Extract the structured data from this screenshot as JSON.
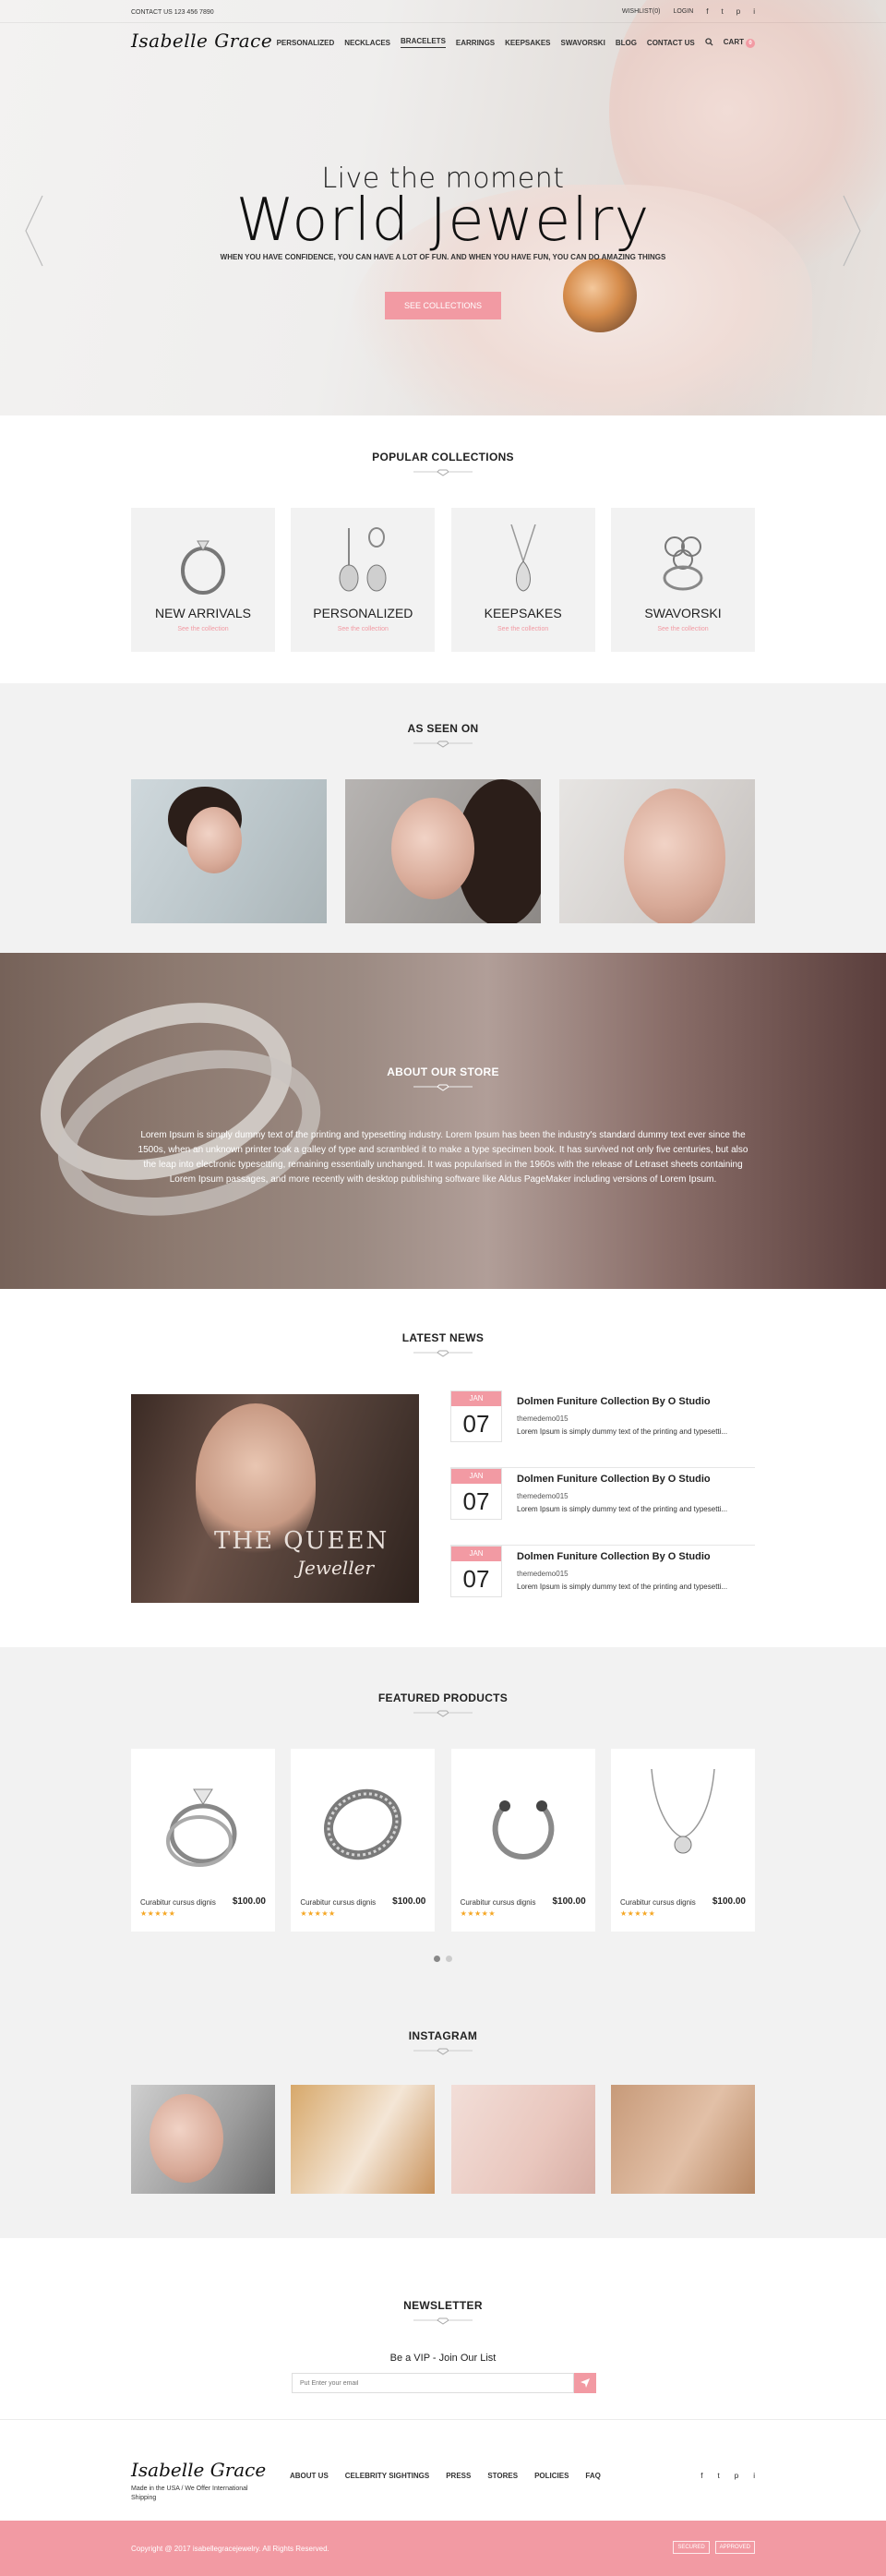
{
  "topbar": {
    "contact": "CONTACT US   123 456 7890",
    "wishlist": "WISHLIST(0)",
    "login": "LOGIN",
    "social": [
      "f",
      "t",
      "p",
      "i"
    ]
  },
  "brand": {
    "logo": "Isabelle Grace"
  },
  "nav": {
    "items": [
      "PERSONALIZED",
      "NECKLACES",
      "BRACELETS",
      "EARRINGS",
      "KEEPSAKES",
      "SWAVORSKI",
      "BLOG",
      "CONTACT US"
    ],
    "active_index": 2,
    "cart_label": "CART",
    "cart_count": "0"
  },
  "hero": {
    "subtitle": "Live the moment",
    "title": "World Jewelry",
    "tagline": "WHEN YOU HAVE CONFIDENCE, YOU CAN HAVE A LOT OF FUN. AND WHEN YOU HAVE FUN, YOU CAN DO AMAZING THINGS",
    "cta": "SEE COLLECTIONS"
  },
  "popular": {
    "title": "POPULAR COLLECTIONS",
    "items": [
      {
        "name": "NEW ARRIVALS",
        "link": "See the collection"
      },
      {
        "name": "PERSONALIZED",
        "link": "See the collection"
      },
      {
        "name": "KEEPSAKES",
        "link": "See the collection"
      },
      {
        "name": "SWAVORSKI",
        "link": "See the collection"
      }
    ]
  },
  "seen": {
    "title": "AS SEEN ON"
  },
  "about": {
    "title": "ABOUT OUR STORE",
    "text": "Lorem Ipsum is simply dummy text of the printing and typesetting industry. Lorem Ipsum has been the industry's standard dummy text ever since the 1500s, when an unknown printer took a galley of type and scrambled it to make a type specimen book. It has survived not only five centuries, but also the leap into electronic typesetting, remaining essentially unchanged. It was popularised in the 1960s with the release of Letraset sheets containing Lorem Ipsum passages, and more recently with desktop publishing software like Aldus PageMaker including versions of Lorem Ipsum."
  },
  "news": {
    "title": "LATEST NEWS",
    "feature_title": "THE QUEEN",
    "feature_sub": "Jeweller",
    "items": [
      {
        "month": "JAN",
        "day": "07",
        "title": "Dolmen Funiture Collection By O Studio",
        "author": "themedemo015",
        "excerpt": "Lorem Ipsum is simply dummy text of the printing and typesetti..."
      },
      {
        "month": "JAN",
        "day": "07",
        "title": "Dolmen Funiture Collection By O Studio",
        "author": "themedemo015",
        "excerpt": "Lorem Ipsum is simply dummy text of the printing and typesetti..."
      },
      {
        "month": "JAN",
        "day": "07",
        "title": "Dolmen Funiture Collection By O Studio",
        "author": "themedemo015",
        "excerpt": "Lorem Ipsum is simply dummy text of the printing and typesetti..."
      }
    ]
  },
  "featured": {
    "title": "FEATURED PRODUCTS",
    "products": [
      {
        "name": "Curabitur cursus dignis",
        "price": "$100.00",
        "stars": "★★★★★"
      },
      {
        "name": "Curabitur cursus dignis",
        "price": "$100.00",
        "stars": "★★★★★"
      },
      {
        "name": "Curabitur cursus dignis",
        "price": "$100.00",
        "stars": "★★★★★"
      },
      {
        "name": "Curabitur cursus dignis",
        "price": "$100.00",
        "stars": "★★★★★"
      }
    ]
  },
  "instagram": {
    "title": "INSTAGRAM"
  },
  "newsletter": {
    "title": "NEWSLETTER",
    "subtitle": "Be a VIP - Join Our List",
    "placeholder": "Put Enter your email"
  },
  "footer": {
    "logo": "Isabelle Grace",
    "made": "Made in the USA / We Offer International Shipping",
    "links": [
      "ABOUT US",
      "CELEBRITY SIGHTINGS",
      "PRESS",
      "STORES",
      "POLICIES",
      "FAQ"
    ],
    "social": [
      "f",
      "t",
      "p",
      "i"
    ]
  },
  "copyright": {
    "text": "Copyright @ 2017 isabellegracejewelry. All Rights Reserved.",
    "badges": [
      "SECURED",
      "APPROVED"
    ]
  },
  "colors": {
    "accent": "#f29aa3",
    "light_bg": "#f2f2f2"
  }
}
